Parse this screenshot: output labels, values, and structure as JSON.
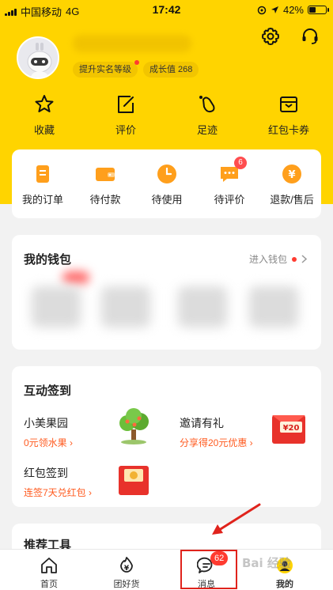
{
  "status_bar": {
    "carrier": "中国移动",
    "network": "4G",
    "time": "17:42",
    "battery": "42%",
    "battery_level": 0.42
  },
  "profile": {
    "verify_tag": "提升实名等级",
    "growth_tag": "成长值 268"
  },
  "icons": {
    "settings": "gear-icon",
    "service": "headset-icon"
  },
  "shortcuts": [
    {
      "label": "收藏",
      "icon": "star-icon"
    },
    {
      "label": "评价",
      "icon": "edit-icon"
    },
    {
      "label": "足迹",
      "icon": "footprint-icon"
    },
    {
      "label": "红包卡券",
      "icon": "coupon-icon"
    }
  ],
  "orders": [
    {
      "label": "我的订单",
      "icon": "order-list-icon"
    },
    {
      "label": "待付款",
      "icon": "wallet-icon"
    },
    {
      "label": "待使用",
      "icon": "clock-icon"
    },
    {
      "label": "待评价",
      "icon": "comment-icon",
      "badge": "6"
    },
    {
      "label": "退款/售后",
      "icon": "refund-icon"
    }
  ],
  "wallet": {
    "title": "我的钱包",
    "link": "进入钱包"
  },
  "sign": {
    "title": "互动签到",
    "items": [
      {
        "title": "小美果园",
        "sub": "0元领水果 ›",
        "icon": "tree-icon"
      },
      {
        "title": "邀请有礼",
        "sub": "分享得20元优惠 ›",
        "icon": "red-envelope-icon",
        "badge_text": "¥20"
      },
      {
        "title": "红包签到",
        "sub": "连签7天兑红包 ›",
        "icon": "red-packet-icon"
      }
    ]
  },
  "tools": {
    "title": "推荐工具"
  },
  "tabbar": [
    {
      "label": "首页",
      "icon": "home-icon"
    },
    {
      "label": "团好货",
      "icon": "yen-flame-icon"
    },
    {
      "label": "消息",
      "icon": "message-icon",
      "badge": "62"
    },
    {
      "label": "我的",
      "icon": "profile-icon"
    }
  ],
  "watermark": "Bai 经验"
}
